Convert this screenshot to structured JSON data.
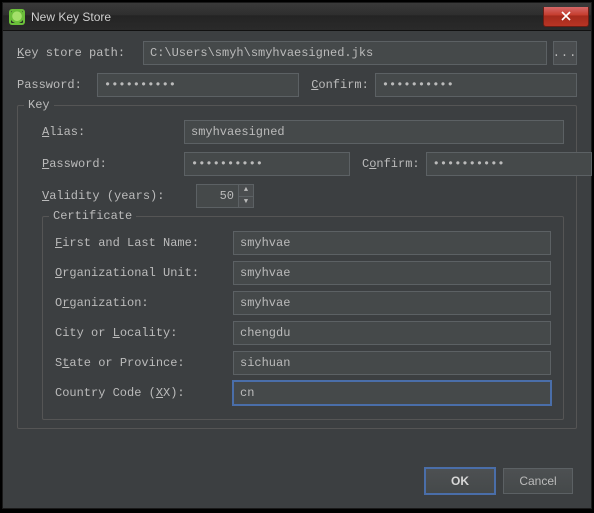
{
  "window": {
    "title": "New Key Store"
  },
  "labels": {
    "key_store_path": "Key store path:",
    "password": "Password:",
    "confirm": "Confirm:",
    "key_group": "Key",
    "alias": "Alias:",
    "key_password": "Password:",
    "key_confirm": "Confirm:",
    "validity": "Validity (years):",
    "cert_group": "Certificate",
    "first_last": "First and Last Name:",
    "org_unit": "Organizational Unit:",
    "org": "Organization:",
    "city": "City or Locality:",
    "state": "State or Province:",
    "country": "Country Code (XX):",
    "ok": "OK",
    "cancel": "Cancel",
    "browse": "..."
  },
  "values": {
    "key_store_path": "C:\\Users\\smyh\\smyhvaesigned.jks",
    "password": "••••••••••",
    "confirm": "••••••••••",
    "alias": "smyhvaesigned",
    "key_password": "••••••••••",
    "key_confirm": "••••••••••",
    "validity": "50",
    "first_last": "smyhvae",
    "org_unit": "smyhvae",
    "org": "smyhvae",
    "city": "chengdu",
    "state": "sichuan",
    "country": "cn"
  }
}
